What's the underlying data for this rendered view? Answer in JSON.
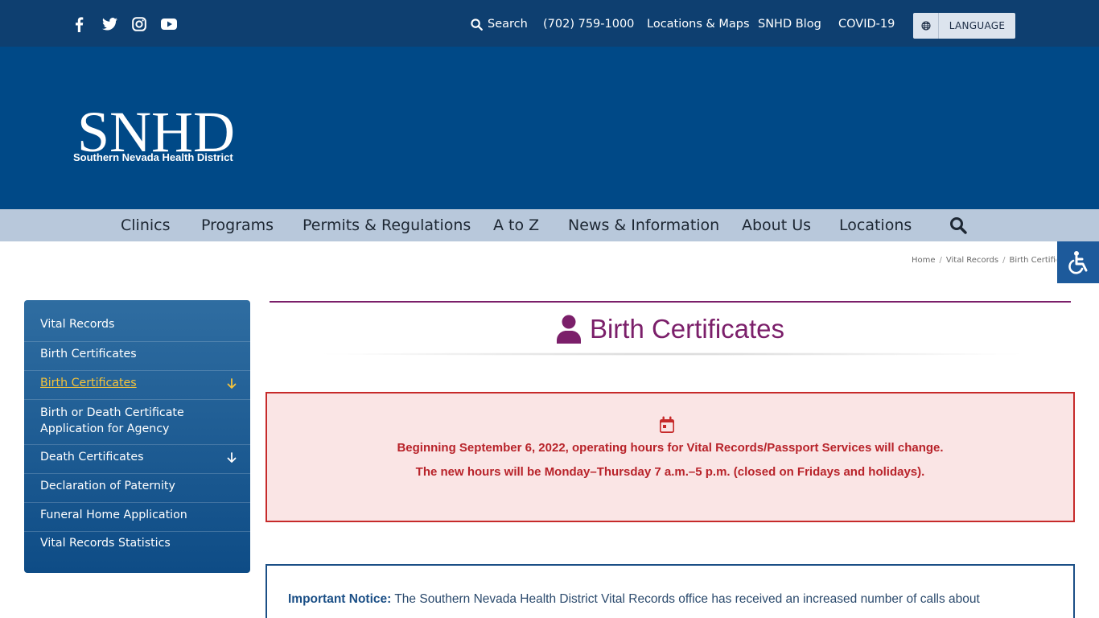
{
  "topbar": {
    "social": [
      "facebook-icon",
      "twitter-icon",
      "instagram-icon",
      "youtube-icon"
    ],
    "search_label": "Search",
    "phone": "(702) 759-1000",
    "locations": "Locations & Maps",
    "blog": "SNHD Blog",
    "covid": "COVID-19",
    "language_label": "LANGUAGE"
  },
  "header": {
    "logo_letters": "SNHD",
    "logo_subtitle": "Southern Nevada Health District"
  },
  "mainnav": {
    "items": [
      "Clinics",
      "Programs",
      "Permits & Regulations",
      "A to Z",
      "News & Information",
      "About Us",
      "Locations"
    ]
  },
  "breadcrumb": {
    "home": "Home",
    "vital": "Vital Records",
    "current": "Birth Certific"
  },
  "sidebar": {
    "items": [
      {
        "label": "Vital Records"
      },
      {
        "label": "Birth Certificates"
      },
      {
        "label": "Birth Certificates"
      },
      {
        "label": "Birth or Death Certificate Application for Agency"
      },
      {
        "label": "Death Certificates"
      },
      {
        "label": "Declaration of Paternity"
      },
      {
        "label": "Funeral Home Application"
      },
      {
        "label": "Vital Records Statistics"
      }
    ]
  },
  "content": {
    "title": "Birth Certificates",
    "alert": {
      "line1": "Beginning September 6, 2022, operating hours for Vital Records/Passport Services will change.",
      "line2": "The new hours will be Monday–Thursday 7 a.m.–5 p.m. (closed on Fridays and holidays)."
    },
    "notice": {
      "label": "Important Notice:",
      "text": " The Southern Nevada Health District Vital Records office has received an increased number of calls about"
    }
  },
  "colors": {
    "topbar": "#0e3f70",
    "header": "#004987",
    "nav": "#b8c8db",
    "title": "#7b1f6a",
    "alert_text": "#b8232a",
    "sidebar_active": "#f5c33b"
  }
}
